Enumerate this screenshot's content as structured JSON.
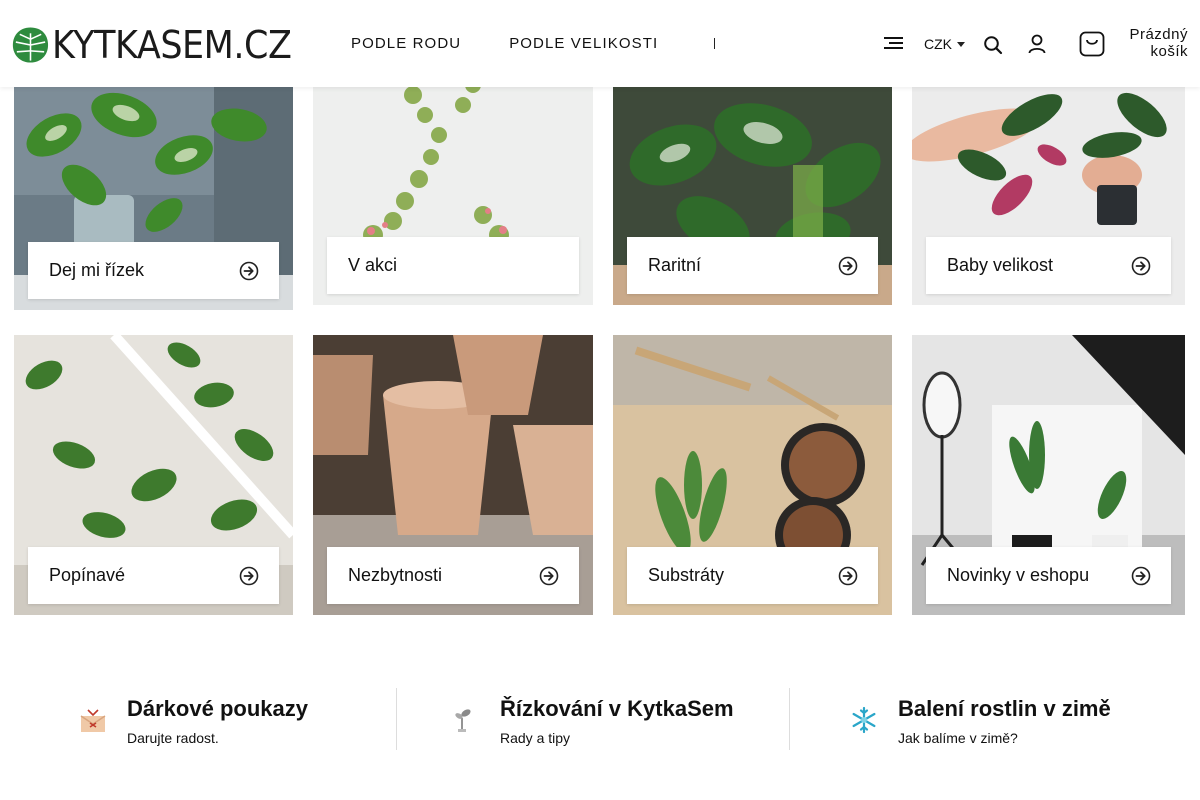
{
  "header": {
    "logo_text": "KYTKASEM.CZ",
    "nav": [
      "PODLE RODU",
      "PODLE VELIKOSTI"
    ],
    "currency": "CZK",
    "cart_line1": "Prázdný",
    "cart_line2": "košík"
  },
  "tiles": [
    {
      "label": "Dej mi řízek"
    },
    {
      "label": "V akci"
    },
    {
      "label": "Raritní"
    },
    {
      "label": "Baby velikost"
    },
    {
      "label": "Popínavé"
    },
    {
      "label": "Nezbytnosti"
    },
    {
      "label": "Substráty"
    },
    {
      "label": "Novinky v eshopu"
    }
  ],
  "features": [
    {
      "title": "Dárkové poukazy",
      "subtitle": "Darujte radost.",
      "icon": "gift-voucher-icon"
    },
    {
      "title": "Řízkování v KytkaSem",
      "subtitle": "Rady a tipy",
      "icon": "cutting-icon"
    },
    {
      "title": "Balení rostlin v zimě",
      "subtitle": "Jak balíme v zimě?",
      "icon": "snowflake-icon"
    }
  ],
  "colors": {
    "brand_green": "#2e8b3e",
    "snow_blue": "#2aa6c9",
    "text": "#111111"
  }
}
